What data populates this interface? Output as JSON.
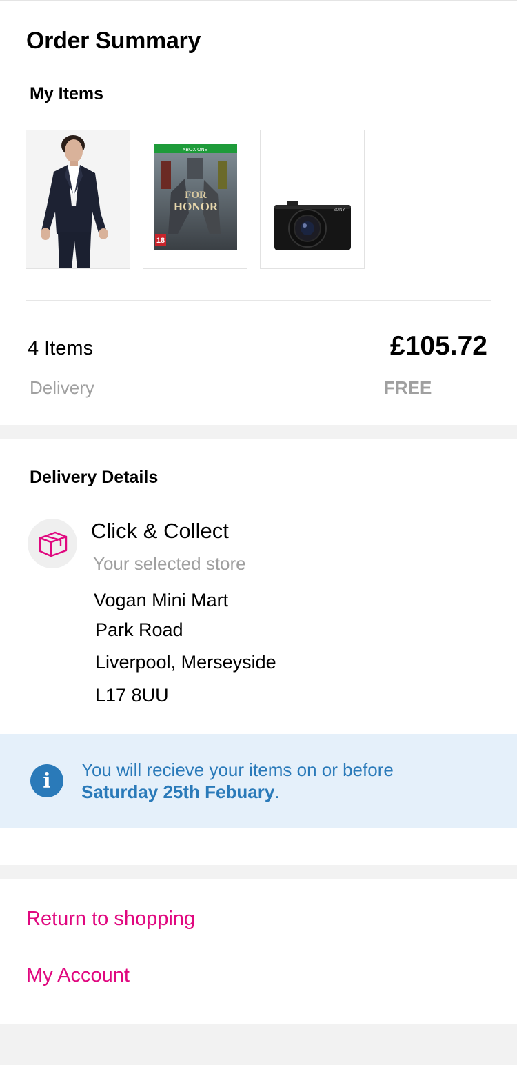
{
  "summary": {
    "title": "Order Summary",
    "my_items_heading": "My Items",
    "items": [
      {
        "kind": "suit",
        "icon": "suit-product-image"
      },
      {
        "kind": "game",
        "icon": "game-cover-image",
        "badge": "XBOX ONE",
        "cover_title_1": "FOR",
        "cover_title_2": "HONOR",
        "age_rating": "18"
      },
      {
        "kind": "camera",
        "icon": "camera-product-image",
        "brand": "SONY"
      }
    ],
    "items_count": "4 Items",
    "total": "£105.72",
    "delivery_label": "Delivery",
    "delivery_value": "FREE"
  },
  "delivery": {
    "heading": "Delivery Details",
    "method_icon": "package-box-icon",
    "method_title": "Click & Collect",
    "method_subtitle": "Your selected store",
    "address": {
      "line1": "Vogan Mini Mart",
      "line2": "Park Road",
      "line3": "Liverpool, Merseyside",
      "line4": "L17 8UU"
    },
    "info": {
      "icon": "info-icon",
      "icon_glyph": "i",
      "text": "You will recieve your items on or before",
      "date": "Saturday 25th Febuary",
      "suffix": "."
    }
  },
  "links": {
    "return_shopping": "Return to shopping",
    "my_account": "My Account"
  },
  "colors": {
    "accent_pink": "#e0087f",
    "info_blue": "#2a7ab9",
    "info_bg": "#e5f0fa",
    "muted_text": "#a0a0a0",
    "page_bg": "#f2f2f2"
  }
}
